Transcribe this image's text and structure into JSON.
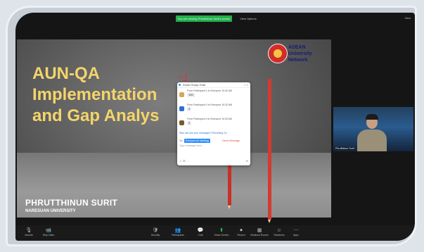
{
  "meeting": {
    "share_banner": "You are viewing Phrutthinun Surit's screen",
    "stop_label": "View Options",
    "view_label": "View"
  },
  "slide": {
    "title_line1": "AUN-QA",
    "title_line2": "Implementation",
    "title_line3": "and Gap Analys",
    "presenter": "PHRUTTHINUN SURIT",
    "organization": "NARESUAN UNIVERSITY",
    "logo_text_1": "ASEAN",
    "logo_text_2": "University",
    "logo_text_3": "Network",
    "annotation": "~1"
  },
  "chat": {
    "header": "Zoom Group Chat",
    "messages": [
      {
        "line": "From Participant 1 to Everyone 10:32 AM",
        "value": "100",
        "avatar_color": "#d9a45b"
      },
      {
        "line": "From Participant 2 to Everyone 10:32 AM",
        "value": "2",
        "avatar_color": "#2d6fd6"
      },
      {
        "line": "From Participant 3 to Everyone 10:33 AM",
        "value": "2",
        "avatar_color": "#7a5a2a"
      }
    ],
    "note": "Who can see your messages? Recording On",
    "to_label": "To:",
    "to_value": "Everyone (in Meeting)",
    "direct_message": "Direct Message",
    "input_placeholder": "Type message here...",
    "foot_left": "☺ ⊞ ...",
    "foot_send": "➤"
  },
  "video": {
    "name": "Phrutthinun Surit"
  },
  "toolbar": {
    "items": [
      {
        "icon": "🎙",
        "label": "Unmute"
      },
      {
        "icon": "📹",
        "label": "Stop Video"
      },
      {
        "icon": "🛡",
        "label": "Security"
      },
      {
        "icon": "👥",
        "label": "Participants"
      },
      {
        "icon": "💬",
        "label": "Chat"
      },
      {
        "icon": "⬆",
        "label": "Share Screen"
      },
      {
        "icon": "⏺",
        "label": "Record"
      },
      {
        "icon": "▦",
        "label": "Breakout Rooms"
      },
      {
        "icon": "☺",
        "label": "Reactions"
      },
      {
        "icon": "⋯",
        "label": "Apps"
      }
    ]
  }
}
